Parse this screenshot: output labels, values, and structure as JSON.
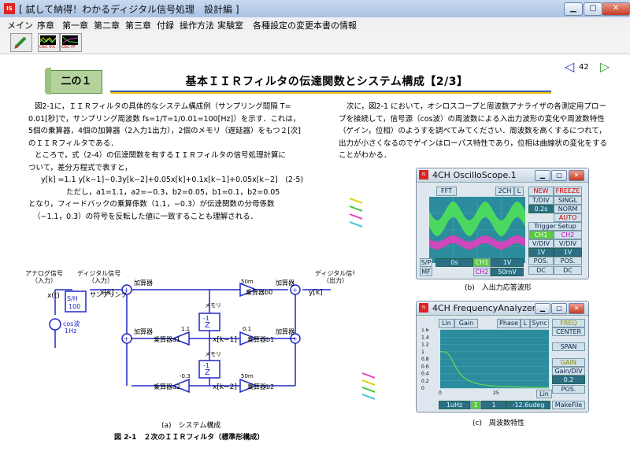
{
  "window": {
    "title": "[ 試して納得！わかるディジタル信号処理　設計編 ]",
    "app_icon": "IS Book"
  },
  "menu": [
    "メイン",
    "序章",
    "第一章",
    "第二章",
    "第三章",
    "付録",
    "操作方法",
    "実験室",
    "各種設定の変更",
    "本書の情報"
  ],
  "toolbar": [
    {
      "icon": "pencil-icon"
    },
    {
      "icon": "scope-icon",
      "label": "OSC 0%"
    },
    {
      "icon": "fft-icon",
      "label": "OSC FF"
    }
  ],
  "section_label": "二の１",
  "page_title": "基本ＩＩＲフィルタの伝達関数とシステム構成【2/3】",
  "page_number": "42",
  "left_text": [
    "図2-1に，ＩＩＲフィルタの具体的なシステム構成例（サンプリング間隔 T=",
    "0.01[秒]で，サンプリング周波数 fs=1/T=1/0.01=100[Hz]）を示す．これは，",
    "5個の乗算器，4個の加算器（2入力1出力），2個のメモリ（遅延器）をもつ２[次]",
    "のＩＩＲフィルタである．",
    "ところで，式（2-4）の伝達関数を有するＩＩＲフィルタの信号処理計算に",
    "ついて，差分方程式で表すと，",
    "y[k] =1.1 y[k−1]−0.3y[k−2]+0.05x[k]+0.1x[k−1]+0.05x[k−2]　(2-5)",
    "ただし，a1=1.1，a2=−0.3，b2=0.05，b1=0.1，b2=0.05",
    "となり，フィードバックの乗算係数（1.1，−0.3）が伝達関数の分母係数",
    "（−1.1，0.3）の符号を反転した値に一致することも理解される．"
  ],
  "right_text": [
    "次に，図2-1 において，オシロスコープと周波数アナライザの各測定用プロー",
    "ブを接続して，信号源（cos波）の周波数による入出力波形の変化や周波数特性",
    "（ゲイン，位相）のようすを調べてみてください．周波数を高くするにつれて，",
    "出力が小さくなるのでゲインはローパス特性であり，位相は曲線状の変化をする",
    "ことがわかる．"
  ],
  "circuit": {
    "analog_label": "アナログ信号\n（入力）",
    "digital_in_label": "ディジタル信号\n（入力）",
    "digital_out_label": "ディジタル信号\n（出力）",
    "sampling_label": "サンプリング",
    "xt": "x(t)",
    "xk": "x[k]",
    "xk1": "x[k−1]",
    "xk2": "x[k−2]",
    "yk": "y[k]",
    "sh_block": [
      "S/H",
      "100"
    ],
    "source": [
      "cos波",
      "1Hz"
    ],
    "adder": "加算器",
    "memory": "メモリ",
    "delay": "Z",
    "multipliers": [
      {
        "name": "乗算器b0",
        "coef": "50m"
      },
      {
        "name": "乗算器a1",
        "coef": "1.1"
      },
      {
        "name": "乗算器b1",
        "coef": "0.1"
      },
      {
        "name": "乗算器a2",
        "coef": "-0.3"
      },
      {
        "name": "乗算器b2",
        "coef": "50m"
      }
    ],
    "caption_a": "(a)　システム構成",
    "figure_caption": "図 2-1　２次のＩＩＲフィルタ（標準形構成）"
  },
  "oscilloscope": {
    "title": "4CH OscilloScope.1",
    "top_buttons": [
      "FFT",
      "2CH",
      "L",
      "NEW",
      "FREEZE"
    ],
    "right_controls": [
      "T/DIV",
      "SINGL",
      "0.2s",
      "NORM",
      "AUTO",
      "Trigger Setup",
      "CH1",
      "CH2",
      "V/DIV",
      "V/DIV",
      "1V",
      "1V",
      "POS.",
      "POS.",
      "DC",
      "DC"
    ],
    "bottom": [
      "S/P",
      "0s",
      "CH1",
      "1V",
      "MF",
      "CH2",
      "50mV"
    ],
    "caption": "(b)　入出力応答波形"
  },
  "analyzer": {
    "title": "4CH FrequencyAnalyzer.1",
    "top_buttons": [
      "Lin",
      "Gain",
      "Phase",
      "L",
      "Sync"
    ],
    "y_ticks": [
      "1.6",
      "1.4",
      "1.2",
      "1",
      "0.8",
      "0.6",
      "0.4",
      "0.2",
      "0"
    ],
    "x_ticks": [
      "0",
      "25",
      "50"
    ],
    "right_controls": [
      "FREQ",
      "CENTER",
      "SPAN",
      "GAIN",
      "Gain/DIV",
      "0.2",
      "POS.",
      "Lin"
    ],
    "bottom": [
      "1uHz",
      "1",
      "1",
      "-12.6udeg",
      "MakeFile"
    ],
    "caption": "(c)　周波数特性"
  },
  "colors": {
    "scope_bg": "#2a8c9c",
    "ch1": "#4fe05a",
    "ch2": "#e040c0",
    "analyzer_bg": "#2a8c9c",
    "curve": "#6cdc50",
    "circuit": "#2028c8"
  }
}
